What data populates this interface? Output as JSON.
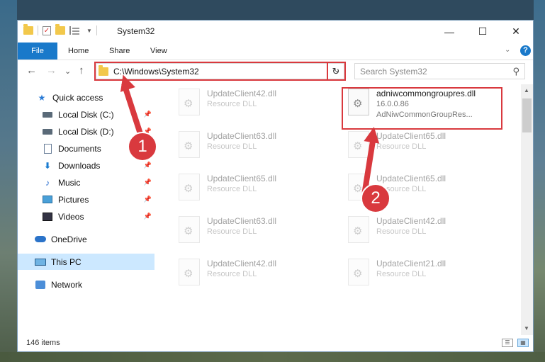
{
  "window": {
    "title": "System32"
  },
  "controls": {
    "minimize": "—",
    "maximize": "☐",
    "close": "✕"
  },
  "ribbon": {
    "file": "File",
    "home": "Home",
    "share": "Share",
    "view": "View",
    "chevron": "⌄",
    "help": "?"
  },
  "nav": {
    "back": "←",
    "forward": "→",
    "recent": "⌄",
    "up": "↑",
    "refresh": "↻"
  },
  "address": {
    "path": "C:\\Windows\\System32",
    "dropdown": "⌄"
  },
  "search": {
    "placeholder": "Search System32",
    "icon": "⚲"
  },
  "sidebar": {
    "items": [
      {
        "label": "Quick access",
        "icon": "star-icon",
        "pinned": false
      },
      {
        "label": "Local Disk (C:)",
        "icon": "disk-icon",
        "pinned": true
      },
      {
        "label": "Local Disk (D:)",
        "icon": "disk-icon",
        "pinned": true
      },
      {
        "label": "Documents",
        "icon": "document-icon",
        "pinned": true
      },
      {
        "label": "Downloads",
        "icon": "download-icon",
        "pinned": true
      },
      {
        "label": "Music",
        "icon": "music-icon",
        "pinned": true
      },
      {
        "label": "Pictures",
        "icon": "pictures-icon",
        "pinned": true
      },
      {
        "label": "Videos",
        "icon": "videos-icon",
        "pinned": true
      },
      {
        "label": "OneDrive",
        "icon": "cloud-icon",
        "pinned": false
      },
      {
        "label": "This PC",
        "icon": "pc-icon",
        "pinned": false,
        "selected": true
      },
      {
        "label": "Network",
        "icon": "network-icon",
        "pinned": false
      }
    ]
  },
  "files": {
    "highlighted": {
      "name": "adniwcommongroupres.dll",
      "version": "16.0.0.86",
      "description": "AdNiwCommonGroupRes..."
    },
    "items": [
      {
        "name": "UpdateClient42.dll",
        "type": "Resource DLL"
      },
      {
        "name": "UpdateClient63.dll",
        "type": "Resource DLL"
      },
      {
        "name": "UpdateClient65.dll",
        "type": "Resource DLL"
      },
      {
        "name": "UpdateClient63.dll",
        "type": "Resource DLL"
      },
      {
        "name": "UpdateClient42.dll",
        "type": "Resource DLL"
      },
      {
        "name": "UpdateClient65.dll",
        "type": "Resource DLL"
      },
      {
        "name": "UpdateClient65.dll",
        "type": "Resource DLL"
      },
      {
        "name": "UpdateClient42.dll",
        "type": "Resource DLL"
      },
      {
        "name": "UpdateClient21.dll",
        "type": "Resource DLL"
      }
    ]
  },
  "status": {
    "count": "146 items"
  },
  "callouts": {
    "one": "1",
    "two": "2"
  },
  "colors": {
    "accent": "#1979ca",
    "highlight": "#d9393e",
    "selection": "#cce8ff"
  }
}
